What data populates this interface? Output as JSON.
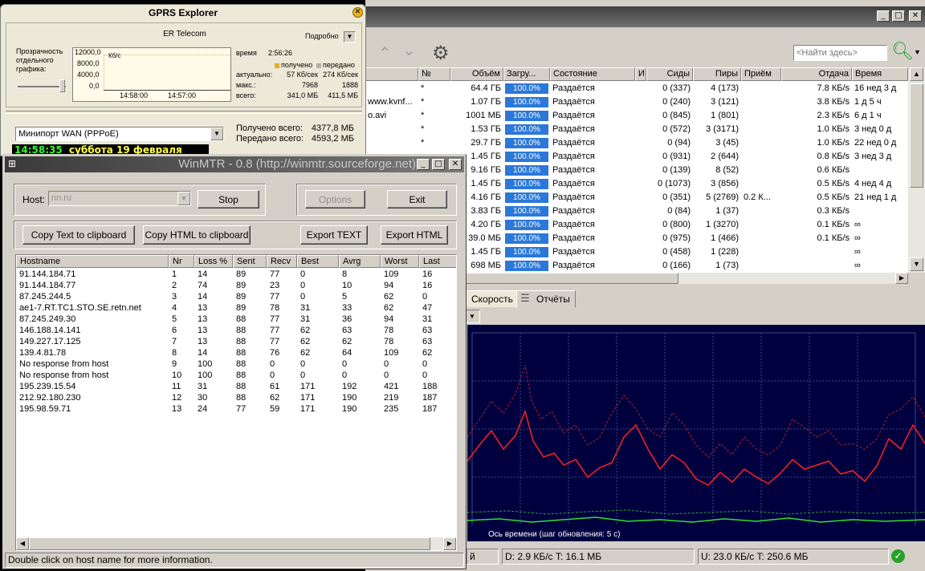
{
  "utorrent": {
    "search_placeholder": "<Найти здесь>",
    "columns": [
      "№",
      "Объём",
      "Загру...",
      "Состояние",
      "И",
      "Сиды",
      "Пиры",
      "Приём",
      "Отдача",
      "Время"
    ],
    "rows": [
      {
        "name": "",
        "num": "*",
        "size": "64.4 ГБ",
        "progress": "100.0%",
        "status": "Раздаётся",
        "seeds": "0 (337)",
        "peers": "4 (173)",
        "down": "",
        "up": "7.8 КБ/s",
        "eta": "16 нед 3 д"
      },
      {
        "name": "www.kvnf...",
        "num": "*",
        "size": "1.07 ГБ",
        "progress": "100.0%",
        "status": "Раздаётся",
        "seeds": "0 (240)",
        "peers": "3 (121)",
        "down": "",
        "up": "3.8 КБ/s",
        "eta": "1 д 5 ч"
      },
      {
        "name": "o.avi",
        "num": "*",
        "size": "1001 МБ",
        "progress": "100.0%",
        "status": "Раздаётся",
        "seeds": "0 (845)",
        "peers": "1 (801)",
        "down": "",
        "up": "2.3 КБ/s",
        "eta": "6 д 1 ч"
      },
      {
        "name": "",
        "num": "*",
        "size": "1.53 ГБ",
        "progress": "100.0%",
        "status": "Раздаётся",
        "seeds": "0 (572)",
        "peers": "3 (3171)",
        "down": "",
        "up": "1.0 КБ/s",
        "eta": "3 нед 0 д"
      },
      {
        "name": "",
        "num": "*",
        "size": "29.7 ГБ",
        "progress": "100.0%",
        "status": "Раздаётся",
        "seeds": "0 (94)",
        "peers": "3 (45)",
        "down": "",
        "up": "1.0 КБ/s",
        "eta": "22 нед 0 д"
      },
      {
        "name": "",
        "num": "",
        "size": "1.45 ГБ",
        "progress": "100.0%",
        "status": "Раздаётся",
        "seeds": "0 (931)",
        "peers": "2 (644)",
        "down": "",
        "up": "0.8 КБ/s",
        "eta": "3 нед 3 д"
      },
      {
        "name": "",
        "num": "",
        "size": "9.16 ГБ",
        "progress": "100.0%",
        "status": "Раздаётся",
        "seeds": "0 (139)",
        "peers": "8 (52)",
        "down": "",
        "up": "0.6 КБ/s",
        "eta": ""
      },
      {
        "name": "",
        "num": "",
        "size": "1.45 ГБ",
        "progress": "100.0%",
        "status": "Раздаётся",
        "seeds": "0 (1073)",
        "peers": "3 (856)",
        "down": "",
        "up": "0.5 КБ/s",
        "eta": "4 нед 4 д"
      },
      {
        "name": "",
        "num": "",
        "size": "4.16 ГБ",
        "progress": "100.0%",
        "status": "Раздаётся",
        "seeds": "0 (351)",
        "peers": "5 (2769)",
        "down": "0.2 К...",
        "up": "0.5 КБ/s",
        "eta": "21 нед 1 д"
      },
      {
        "name": "",
        "num": "",
        "size": "3.83 ГБ",
        "progress": "100.0%",
        "status": "Раздаётся",
        "seeds": "0 (84)",
        "peers": "1 (37)",
        "down": "",
        "up": "0.3 КБ/s",
        "eta": ""
      },
      {
        "name": "",
        "num": "",
        "size": "4.20 ГБ",
        "progress": "100.0%",
        "status": "Раздаётся",
        "seeds": "0 (800)",
        "peers": "1 (3270)",
        "down": "",
        "up": "0.1 КБ/s",
        "eta": "∞"
      },
      {
        "name": "",
        "num": "",
        "size": "39.0 МБ",
        "progress": "100.0%",
        "status": "Раздаётся",
        "seeds": "0 (975)",
        "peers": "1 (466)",
        "down": "",
        "up": "0.1 КБ/s",
        "eta": "∞"
      },
      {
        "name": "",
        "num": "",
        "size": "1.45 ГБ",
        "progress": "100.0%",
        "status": "Раздаётся",
        "seeds": "0 (458)",
        "peers": "1 (228)",
        "down": "",
        "up": "",
        "eta": "∞"
      },
      {
        "name": "",
        "num": "",
        "size": "698 МБ",
        "progress": "100.0%",
        "status": "Раздаётся",
        "seeds": "0 (166)",
        "peers": "1 (73)",
        "down": "",
        "up": "",
        "eta": "∞"
      }
    ],
    "tabs": [
      "Скорость",
      "Отчёты"
    ],
    "graph_caption": "Ось времени (шаг обновления: 5 с)",
    "status_left": "й",
    "status_down": "D: 2.9 КБ/с T: 16.1 МБ",
    "status_up": "U: 23.0 КБ/с T: 250.6 МБ"
  },
  "gprs": {
    "title": "GPRS Explorer",
    "provider": "ER Telecom",
    "detail_label": "Подробно",
    "transparency_label": "Прозрачность отдельного графика:",
    "yaxis": [
      "12000,0",
      "8000,0",
      "4000,0",
      "0,0"
    ],
    "unit": "Кб/с",
    "xaxis": [
      "14:58:00",
      "14:57:00"
    ],
    "time_label": "время",
    "time_value": "2:56:26",
    "legend_received": "получено",
    "legend_sent": "передано",
    "rows": [
      {
        "label": "актуально:",
        "a": "57 Кб/сек",
        "b": "274 Кб/сек"
      },
      {
        "label": "макс.:",
        "a": "7968",
        "b": "1888"
      },
      {
        "label": "всего:",
        "a": "341,0 МБ",
        "b": "411,5 МБ"
      }
    ],
    "adapter": "Минипорт WAN (PPPoE)",
    "received_total_label": "Получено всего:",
    "received_total": "4377,8 МБ",
    "sent_total_label": "Передано всего:",
    "sent_total": "4593,2 МБ"
  },
  "clock": {
    "time": "14:58:35",
    "date": "суббота 19 февраля 2011"
  },
  "winmtr": {
    "title": "WinMTR - 0.8 (http://winmtr.sourceforge.net)",
    "host_label": "Host:",
    "host_value": "nn.ru",
    "stop": "Stop",
    "options": "Options",
    "exit": "Exit",
    "copy_text": "Copy Text to clipboard",
    "copy_html": "Copy HTML to clipboard",
    "export_text": "Export TEXT",
    "export_html": "Export HTML",
    "columns": [
      "Hostname",
      "Nr",
      "Loss %",
      "Sent",
      "Recv",
      "Best",
      "Avrg",
      "Worst",
      "Last"
    ],
    "rows": [
      [
        "91.144.184.71",
        "1",
        "14",
        "89",
        "77",
        "0",
        "8",
        "109",
        "16"
      ],
      [
        "91.144.184.77",
        "2",
        "74",
        "89",
        "23",
        "0",
        "10",
        "94",
        "16"
      ],
      [
        "87.245.244.5",
        "3",
        "14",
        "89",
        "77",
        "0",
        "5",
        "62",
        "0"
      ],
      [
        "ae1-7.RT.TC1.STO.SE.retn.net",
        "4",
        "13",
        "89",
        "78",
        "31",
        "33",
        "62",
        "47"
      ],
      [
        "87.245.249.30",
        "5",
        "13",
        "88",
        "77",
        "31",
        "36",
        "94",
        "31"
      ],
      [
        "146.188.14.141",
        "6",
        "13",
        "88",
        "77",
        "62",
        "63",
        "78",
        "63"
      ],
      [
        "149.227.17.125",
        "7",
        "13",
        "88",
        "77",
        "62",
        "62",
        "78",
        "63"
      ],
      [
        "139.4.81.78",
        "8",
        "14",
        "88",
        "76",
        "62",
        "64",
        "109",
        "62"
      ],
      [
        "No response from host",
        "9",
        "100",
        "88",
        "0",
        "0",
        "0",
        "0",
        "0"
      ],
      [
        "No response from host",
        "10",
        "100",
        "88",
        "0",
        "0",
        "0",
        "0",
        "0"
      ],
      [
        "195.239.15.54",
        "11",
        "31",
        "88",
        "61",
        "171",
        "192",
        "421",
        "188"
      ],
      [
        "212.92.180.230",
        "12",
        "30",
        "88",
        "62",
        "171",
        "190",
        "219",
        "187"
      ],
      [
        "195.98.59.71",
        "13",
        "24",
        "77",
        "59",
        "171",
        "190",
        "235",
        "187"
      ]
    ],
    "status": "Double click on host name for more information."
  }
}
